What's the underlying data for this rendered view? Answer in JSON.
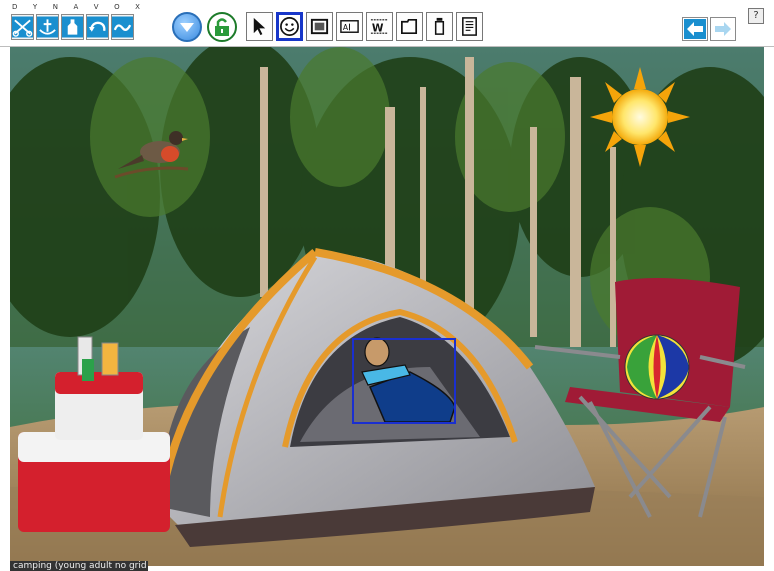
{
  "toolbar": {
    "brand_letters": [
      "D",
      "Y",
      "N",
      "A",
      "V",
      "O",
      "X"
    ],
    "edit_tools": [
      "scissors-icon",
      "anchor-icon",
      "bottle-icon",
      "undo-icon",
      "redo-icon"
    ],
    "nav_down": "navigate-down-icon",
    "lock": "lock-icon",
    "object_tools": [
      "pointer-icon",
      "smiley-icon",
      "frame-icon",
      "text-label-icon",
      "word-icon",
      "folder-icon",
      "jar-icon",
      "page-icon"
    ],
    "selected_tool": "smiley-icon",
    "back": "back-arrow-icon",
    "forward": "forward-arrow-icon",
    "help_label": "?"
  },
  "scene": {
    "page_label": "camping (young adult no grid do",
    "objects": [
      "bird",
      "sun",
      "tent",
      "child-in-sleeping-bag",
      "coolers",
      "drinks",
      "camp-chair",
      "beach-ball"
    ],
    "selected_object": "child-in-sleeping-bag"
  },
  "colors": {
    "selection_border": "#1a2fd0",
    "toolbar_icon_blue": "#1a8fcf",
    "tent_trim": "#e59a2b"
  }
}
